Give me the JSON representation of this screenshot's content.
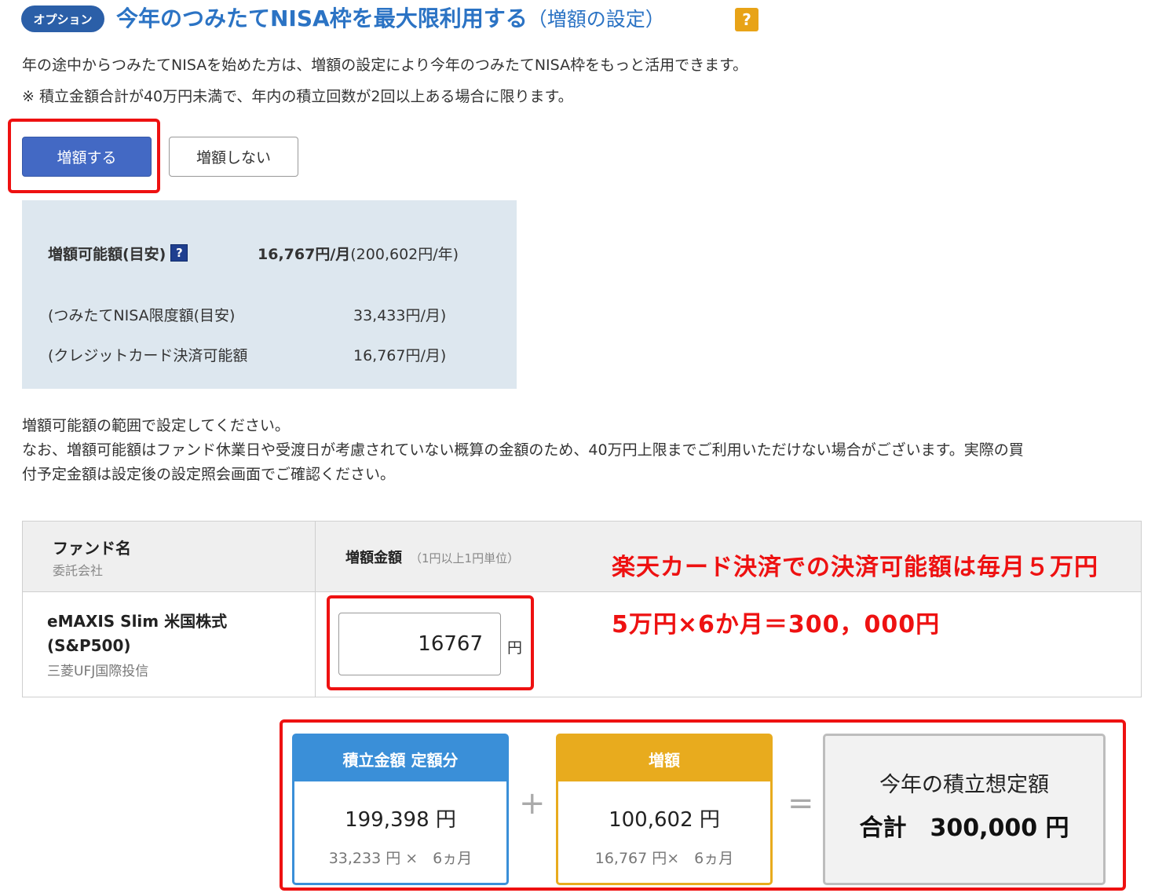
{
  "header": {
    "badge": "オプション",
    "title": "今年のつみたてNISA枠を最大限利用する",
    "subtitle": "（増額の設定）",
    "help": "?"
  },
  "description": {
    "line1": "年の途中からつみたてNISAを始めた方は、増額の設定により今年のつみたてNISA枠をもっと活用できます。",
    "line2": "※ 積立金額合計が40万円未満で、年内の積立回数が2回以上ある場合に限ります。"
  },
  "buttons": {
    "increase": "増額する",
    "no_increase": "増額しない"
  },
  "info": {
    "available_label": "増額可能額(目安)",
    "help": "?",
    "available_monthly": "16,767円/月",
    "available_yearly": "(200,602円/年)",
    "nisa_limit_label": "(つみたてNISA限度額(目安)",
    "nisa_limit_value": "33,433円/月)",
    "credit_label": "(クレジットカード決済可能額",
    "credit_value": "16,767円/月)"
  },
  "note": {
    "line1": "増額可能額の範囲で設定してください。",
    "line2": "なお、増額可能額はファンド休業日や受渡日が考慮されていない概算の金額のため、40万円上限までご利用いただけない場合がございます。実際の買",
    "line3": "付予定金額は設定後の設定照会画面でご確認ください。"
  },
  "table": {
    "col_fund": "ファンド名",
    "col_company": "委託会社",
    "col_amount": "増額金額",
    "col_amount_unit": "（1円以上1円単位）",
    "fund_name_line1": "eMAXIS Slim 米国株式",
    "fund_name_line2": "(S&P500)",
    "fund_company": "三菱UFJ国際投信",
    "amount_value": "16767",
    "amount_unit": "円"
  },
  "annotations": {
    "line1": "楽天カード決済での決済可能額は毎月５万円",
    "line2": "5万円×6か月＝300，000円"
  },
  "summary": {
    "fixed_title": "積立金額 定額分",
    "fixed_total": "199,398 円",
    "fixed_detail": "33,233 円 ×　6ヵ月",
    "plus": "+",
    "increase_title": "増額",
    "increase_total": "100,602 円",
    "increase_detail": "16,767 円×　6ヵ月",
    "equals": "=",
    "total_label": "今年の積立想定額",
    "total_value": "合計　300,000 円"
  },
  "colors": {
    "title_blue": "#2b73c4",
    "button_blue": "#4369c4",
    "highlight_red": "#ee1111",
    "panel_bg": "#dde7ef",
    "card_blue": "#3a8fd8",
    "card_yellow": "#e8ab1e"
  }
}
